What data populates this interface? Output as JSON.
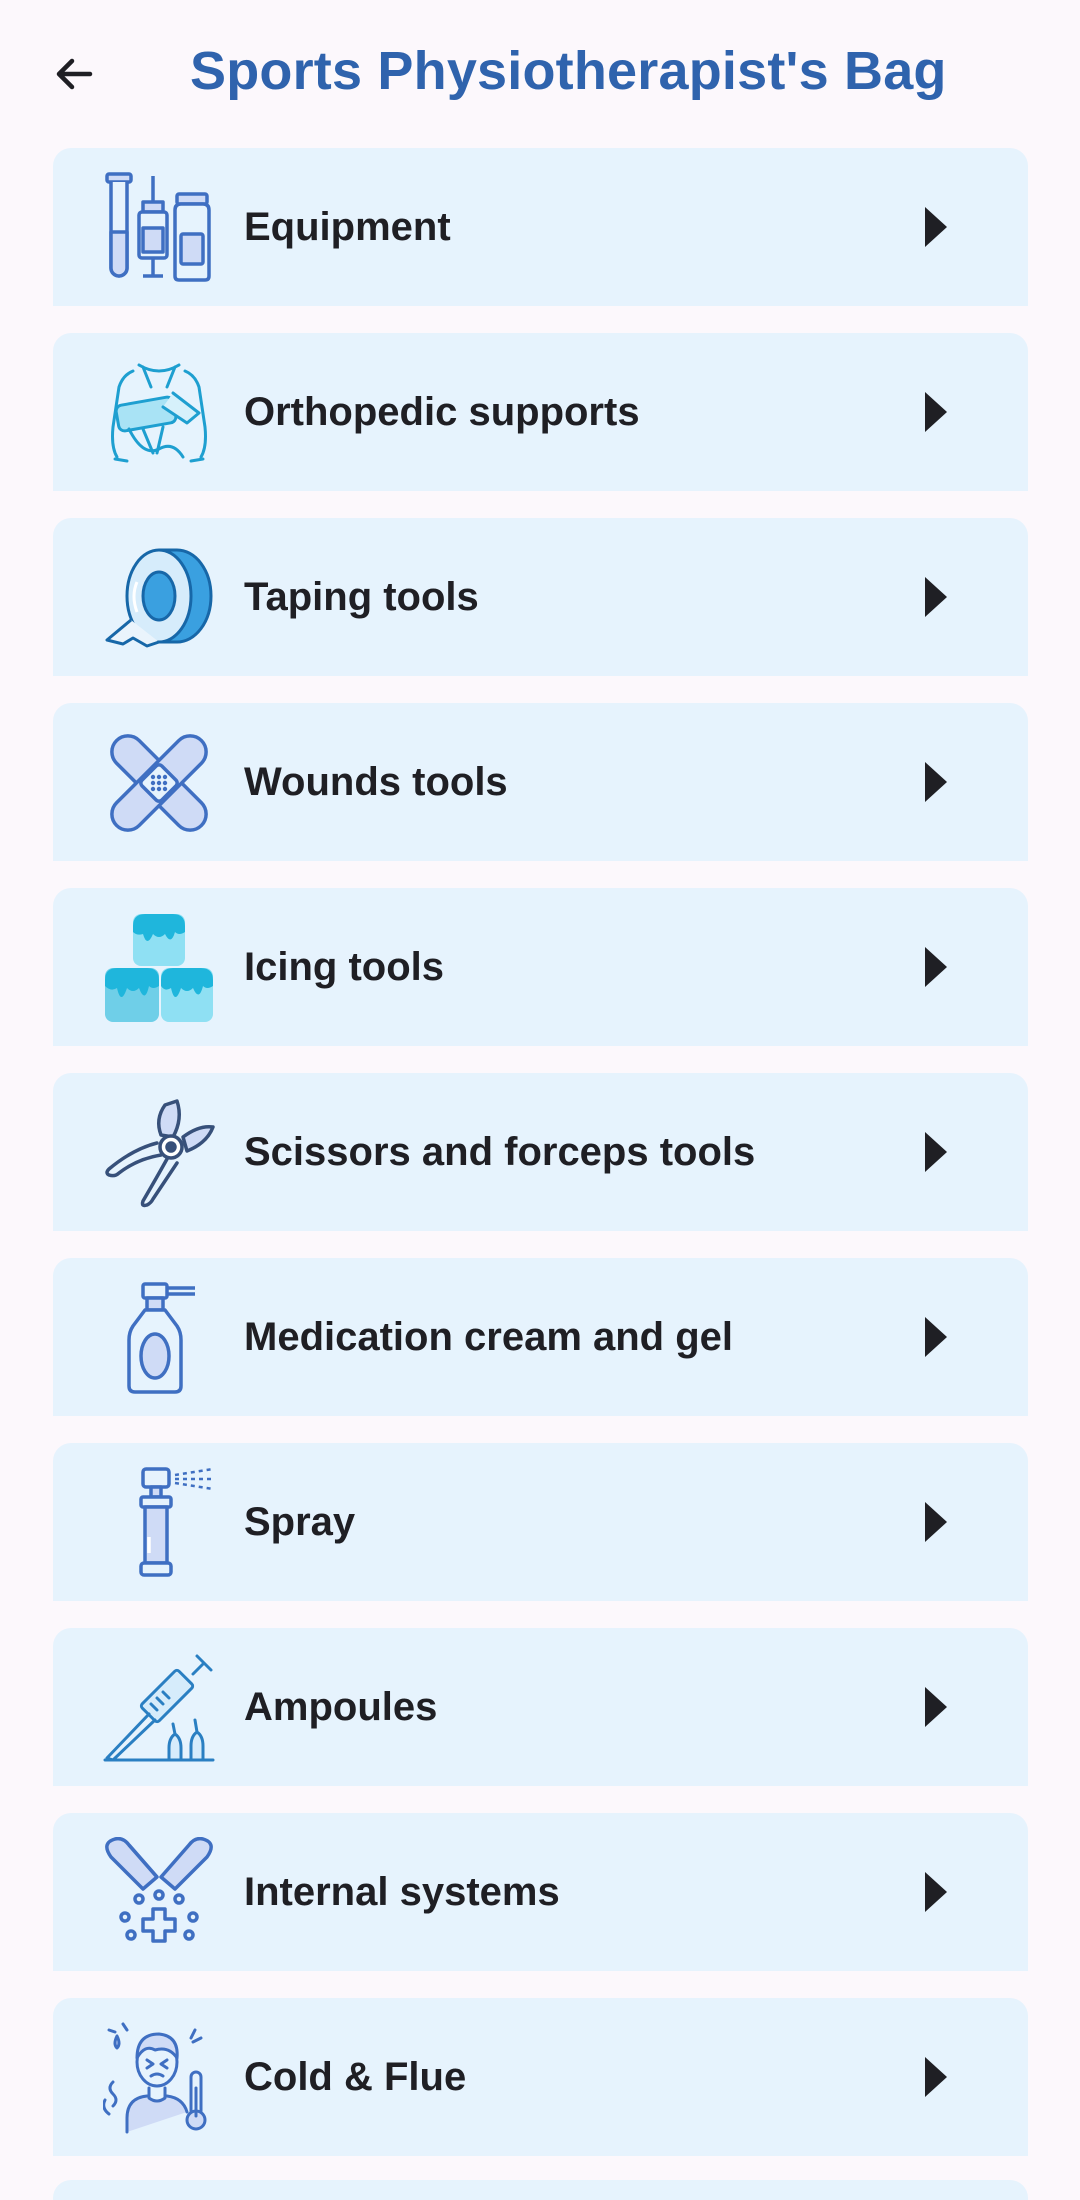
{
  "header": {
    "title": "Sports Physiotherapist's Bag",
    "back_icon": "arrow-left-icon"
  },
  "colors": {
    "title": "#2f63ad",
    "card_bg": "#e6f3fd",
    "page_bg": "#fcf8fc",
    "icon_blue": "#3f6fc2",
    "icon_fill": "#cfdbf6",
    "icon_cyan": "#2ab5d9"
  },
  "categories": [
    {
      "label": "Equipment",
      "icon": "lab-vials-icon"
    },
    {
      "label": "Orthopedic supports",
      "icon": "arm-sling-icon"
    },
    {
      "label": "Taping tools",
      "icon": "tape-roll-icon"
    },
    {
      "label": "Wounds tools",
      "icon": "bandage-icon"
    },
    {
      "label": "Icing tools",
      "icon": "ice-cubes-icon"
    },
    {
      "label": "Scissors and forceps tools",
      "icon": "forceps-icon"
    },
    {
      "label": "Medication cream and gel",
      "icon": "cream-bottle-icon"
    },
    {
      "label": "Spray",
      "icon": "spray-can-icon"
    },
    {
      "label": "Ampoules",
      "icon": "syringe-ampoule-icon"
    },
    {
      "label": "Internal systems",
      "icon": "capsules-icon"
    },
    {
      "label": "Cold & Flue",
      "icon": "sick-person-icon"
    }
  ]
}
